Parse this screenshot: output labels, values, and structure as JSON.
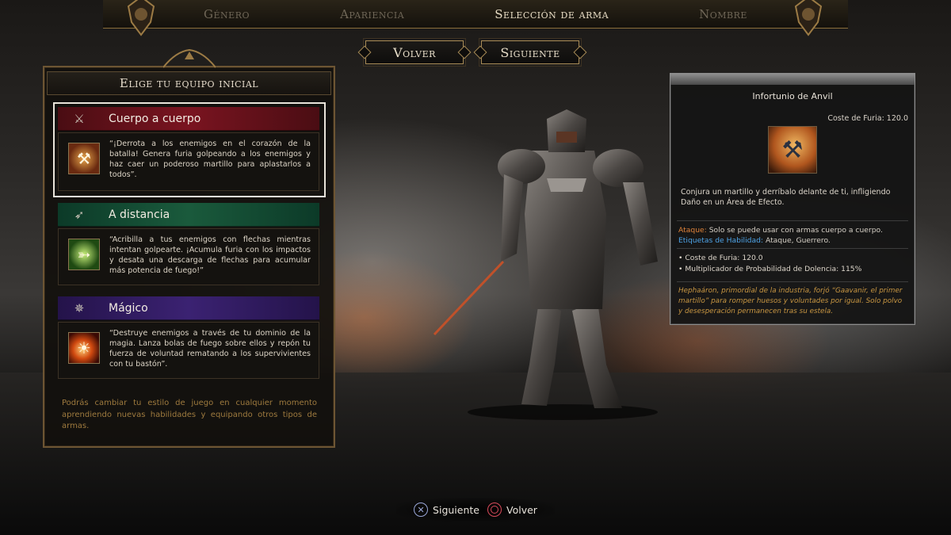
{
  "nav": {
    "steps": [
      {
        "label": "Género",
        "active": false
      },
      {
        "label": "Apariencia",
        "active": false
      },
      {
        "label": "Selección de arma",
        "active": true
      },
      {
        "label": "Nombre",
        "active": false
      }
    ]
  },
  "buttons": {
    "back_label": "Volver",
    "next_label": "Siguiente"
  },
  "equipment_panel": {
    "header": "Elige tu equipo inicial",
    "cards": [
      {
        "title": "Cuerpo a cuerpo",
        "icon": "sword-icon",
        "thumb_icon": "hammer-icon",
        "description": "“¡Derrota a los enemigos en el corazón de la batalla! Genera furia golpeando a los enemigos y haz caer un poderoso martillo para aplastarlos a todos”.",
        "selected": true,
        "color": "#7a1420"
      },
      {
        "title": "A distancia",
        "icon": "bow-icon",
        "thumb_icon": "arrows-icon",
        "description": "“Acribilla a tus enemigos con flechas mientras intentan golpearte. ¡Acumula furia con los impactos y desata una descarga de flechas para acumular más potencia de fuego!”",
        "selected": false,
        "color": "#1a5a3c"
      },
      {
        "title": "Mágico",
        "icon": "staff-icon",
        "thumb_icon": "fireball-icon",
        "description": "“Destruye enemigos a través de tu dominio de la magia. Lanza bolas de fuego sobre ellos y repón tu fuerza de voluntad rematando a los supervivientes con tu bastón”.",
        "selected": false,
        "color": "#3b2272"
      }
    ],
    "footnote": "Podrás cambiar tu estilo de juego en cualquier momento aprendiendo nuevas habilidades y equipando otros tipos de armas."
  },
  "tooltip": {
    "name": "Infortunio de Anvil",
    "cost_top": "Coste de Furia: 120.0",
    "icon": "anvil-hammer-icon",
    "description": "Conjura un martillo y derríbalo delante de ti, infligiendo Daño en un Área de Efecto.",
    "attack_label": "Ataque:",
    "attack_text": "Solo se puede usar con armas cuerpo a cuerpo.",
    "tags_label": "Etiquetas de Habilidad:",
    "tags_text": "Ataque, Guerrero.",
    "stats": [
      "Coste de Furia: 120.0",
      "Multiplicador de Probabilidad de Dolencia: 115%"
    ],
    "lore": "Hephaáron, primordial de la industria, forjó “Gaavanir, el primer martillo” para romper huesos y voluntades por igual. Solo polvo y desesperación permanecen tras su estela."
  },
  "prompts": {
    "next": "Siguiente",
    "back": "Volver"
  },
  "colors": {
    "accent_gold": "#a98c57",
    "attack_orange": "#e0833a",
    "tags_blue": "#4ea3e6",
    "lore_gold": "#c89642"
  }
}
